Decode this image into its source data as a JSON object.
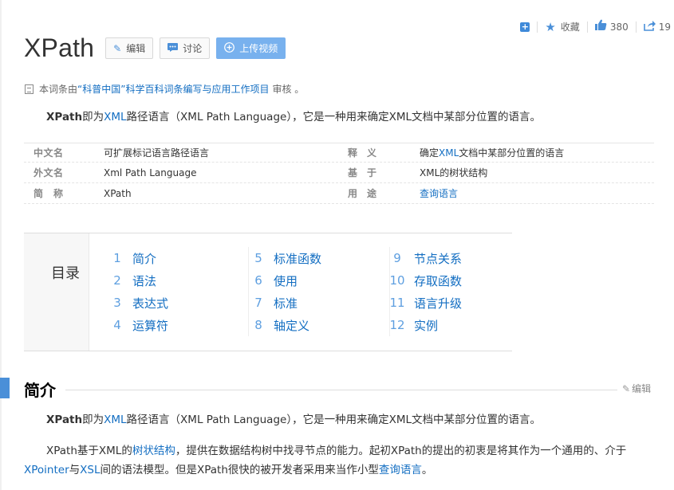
{
  "toolbar": {
    "favorite_label": "收藏",
    "like_count": "380",
    "share_count": "19"
  },
  "header": {
    "title": "XPath",
    "edit_label": "编辑",
    "discuss_label": "讨论",
    "upload_label": "上传视频"
  },
  "review": {
    "prefix": "本词条由",
    "link": "“科普中国”科学百科词条编写与应用工作项目",
    "suffix": "审核 。"
  },
  "summary": {
    "bold": "XPath",
    "t1": "即为",
    "link": "XML",
    "t2": "路径语言（XML Path Language），它是一种用来确定XML文档中某部分位置的语言。"
  },
  "basic_info": {
    "rows": [
      {
        "k1": "中文名",
        "v1": "可扩展标记语言路径语言",
        "k2": "释　义",
        "v2_pre": "确定",
        "v2_link": "XML",
        "v2_post": "文档中某部分位置的语言"
      },
      {
        "k1": "外文名",
        "v1": "Xml Path Language",
        "k2": "基　于",
        "v2_pre": "XML的树状结构",
        "v2_link": "",
        "v2_post": ""
      },
      {
        "k1": "简　称",
        "v1": "XPath",
        "k2": "用　途",
        "v2_pre": "",
        "v2_link": "查询语言",
        "v2_post": ""
      }
    ]
  },
  "catalog": {
    "heading": "目录",
    "columns": [
      [
        {
          "num": "1",
          "label": "简介"
        },
        {
          "num": "2",
          "label": "语法"
        },
        {
          "num": "3",
          "label": "表达式"
        },
        {
          "num": "4",
          "label": "运算符"
        }
      ],
      [
        {
          "num": "5",
          "label": "标准函数"
        },
        {
          "num": "6",
          "label": "使用"
        },
        {
          "num": "7",
          "label": "标准"
        },
        {
          "num": "8",
          "label": "轴定义"
        }
      ],
      [
        {
          "num": "9",
          "label": "节点关系"
        },
        {
          "num": "10",
          "label": "存取函数"
        },
        {
          "num": "11",
          "label": "语言升级"
        },
        {
          "num": "12",
          "label": "实例"
        }
      ]
    ]
  },
  "section": {
    "title": "简介",
    "edit_label": "编辑"
  },
  "intro": {
    "p1_bold": "XPath",
    "p1_t1": "即为",
    "p1_link": "XML",
    "p1_t2": "路径语言（XML Path Language），它是一种用来确定XML文档中某部分位置的语言。",
    "p2_t1": "XPath基于XML的",
    "p2_link1": "树状结构",
    "p2_t2": "，提供在数据结构树中找寻节点的能力。起初XPath的提出的初衷是将其作为一个通用的、介于",
    "p2_link2": "XPointer",
    "p2_t3": "与",
    "p2_link3": "XSL",
    "p2_t4": "间的语法模型。但是XPath很快的被开发者采用来当作小型",
    "p2_link4": "查询语言",
    "p2_t5": "。"
  }
}
